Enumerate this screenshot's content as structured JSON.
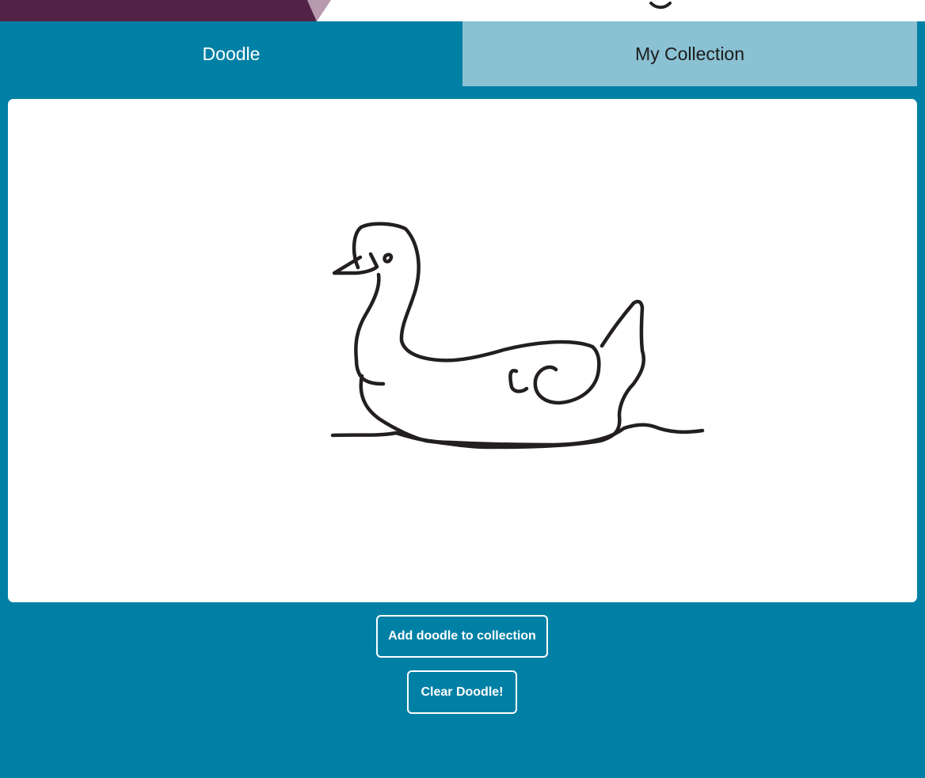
{
  "colors": {
    "page_background": "#0180a5",
    "inactive_tab": "#8ac1d3",
    "header_band": "#522346",
    "header_accent": "#b89aaf",
    "canvas": "#ffffff",
    "ink": "#231f20"
  },
  "tabs": [
    {
      "label": "Doodle",
      "active": true
    },
    {
      "label": "My Collection",
      "active": false
    }
  ],
  "canvas": {
    "drawing_icon": "swan-doodle-icon"
  },
  "actions": {
    "add_label": "Add doodle to collection",
    "clear_label": "Clear Doodle!"
  }
}
